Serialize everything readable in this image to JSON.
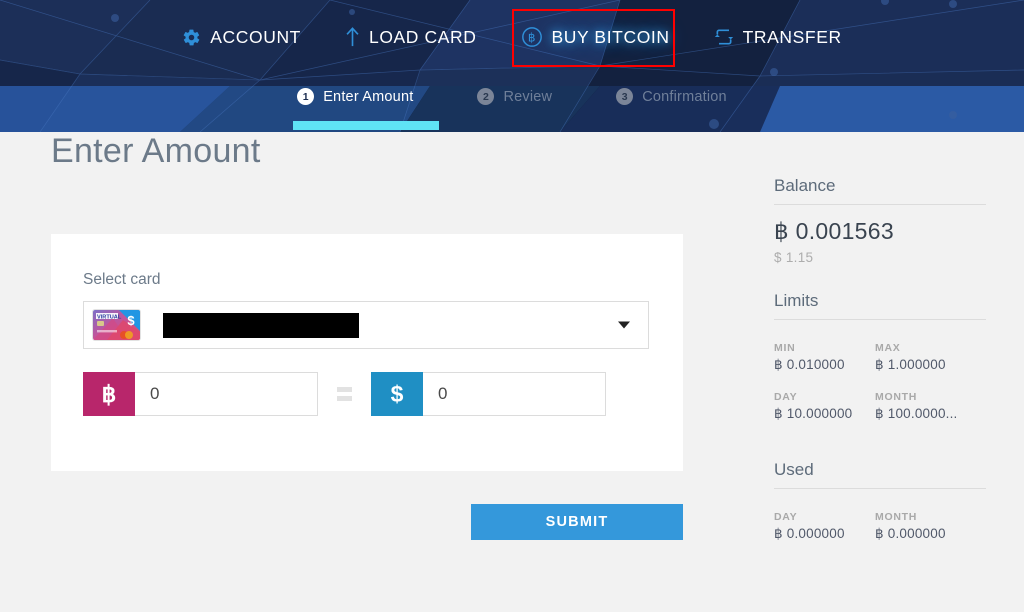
{
  "header": {
    "nav": [
      {
        "label": "ACCOUNT",
        "icon": "gear-icon",
        "active": false
      },
      {
        "label": "LOAD CARD",
        "icon": "up-arrow-icon",
        "active": false
      },
      {
        "label": "BUY BITCOIN",
        "icon": "bitcoin-circle-icon",
        "active": true
      },
      {
        "label": "TRANSFER",
        "icon": "transfer-loop-icon",
        "active": false
      }
    ],
    "steps": [
      {
        "num": "1",
        "label": "Enter Amount",
        "active": true
      },
      {
        "num": "2",
        "label": "Review",
        "active": false
      },
      {
        "num": "3",
        "label": "Confirmation",
        "active": false
      }
    ]
  },
  "main": {
    "title": "Enter Amount",
    "select_card_label": "Select card",
    "card_thumb_text": "VIRTUAL",
    "card_value_redacted": "",
    "btc_sigil": "฿",
    "btc_value": "0",
    "equals_sign": "=",
    "usd_sigil": "$",
    "usd_value": "0",
    "submit_label": "SUBMIT"
  },
  "sidebar": {
    "balance": {
      "title": "Balance",
      "btc": "฿ 0.001563",
      "usd": "$ 1.15"
    },
    "limits": {
      "title": "Limits",
      "rows": [
        {
          "key": "MIN",
          "value": "฿ 0.010000"
        },
        {
          "key": "MAX",
          "value": "฿ 1.000000"
        },
        {
          "key": "DAY",
          "value": "฿ 10.000000"
        },
        {
          "key": "MONTH",
          "value": "฿ 100.0000..."
        }
      ]
    },
    "used": {
      "title": "Used",
      "rows": [
        {
          "key": "DAY",
          "value": "฿ 0.000000"
        },
        {
          "key": "MONTH",
          "value": "฿ 0.000000"
        }
      ]
    }
  },
  "colors": {
    "header_dark": "#1b2d50",
    "accent_cyan": "#5fe3f5",
    "btc_magenta": "#b8266b",
    "usd_blue": "#1f8fc4",
    "submit_blue": "#3498db",
    "annotation_red": "#ff0000"
  }
}
